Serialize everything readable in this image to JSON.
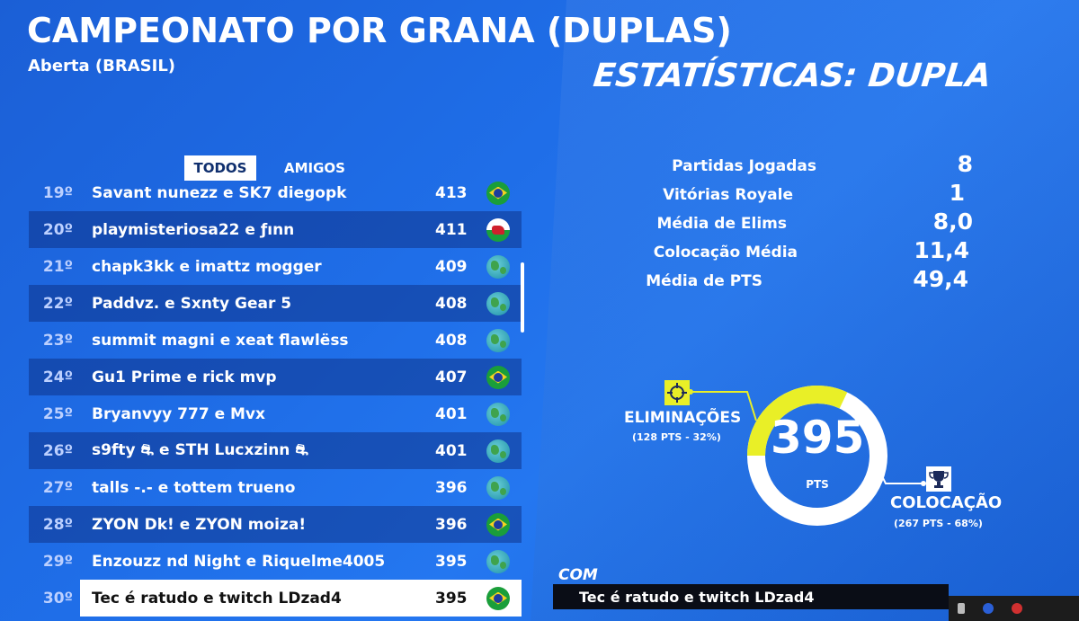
{
  "header": {
    "title": "CAMPEONATO POR GRANA (DUPLAS)",
    "subtitle": "Aberta (BRASIL)",
    "stats_heading": "ESTATÍSTICAS: DUPLA"
  },
  "tabs": [
    {
      "label": "TODOS",
      "active": true
    },
    {
      "label": "AMIGOS",
      "active": false
    }
  ],
  "leaderboard": [
    {
      "rank": "19º",
      "name": "Savant nunezz e SK7 diegopk",
      "score": "413",
      "flag": "brazil-flag-icon"
    },
    {
      "rank": "20º",
      "name": "playmisteriosa22 e ƒınn",
      "score": "411",
      "flag": "wales-flag-icon"
    },
    {
      "rank": "21º",
      "name": "chapk3kk e imattz mogger",
      "score": "409",
      "flag": "globe-icon"
    },
    {
      "rank": "22º",
      "name": "Paddvz. e Sxnty Gear 5",
      "score": "408",
      "flag": "globe-icon"
    },
    {
      "rank": "23º",
      "name": "summit magni e xeat flawlëss",
      "score": "408",
      "flag": "globe-icon"
    },
    {
      "rank": "24º",
      "name": "Gu1 Prime e rick mvp",
      "score": "407",
      "flag": "brazil-flag-icon"
    },
    {
      "rank": "25º",
      "name": "Bryanvyy 777 e Mvx",
      "score": "401",
      "flag": "globe-icon"
    },
    {
      "rank": "26º",
      "name": "s9fty ⛐ e STH Lucxzinn ⛐",
      "score": "401",
      "flag": "globe-icon"
    },
    {
      "rank": "27º",
      "name": "talls -.- e tottem trueno",
      "score": "396",
      "flag": "globe-icon"
    },
    {
      "rank": "28º",
      "name": "ZYON Dk! e ZYON moiza!",
      "score": "396",
      "flag": "brazil-flag-icon"
    },
    {
      "rank": "29º",
      "name": "Enzouzz nd Night e Riquelme4005",
      "score": "395",
      "flag": "globe-icon"
    },
    {
      "rank": "30º",
      "name": "Tec é ratudo e twitch LDzad4",
      "score": "395",
      "flag": "brazil-flag-icon",
      "highlighted": true
    }
  ],
  "stats": [
    {
      "label": "Partidas Jogadas",
      "value": "8"
    },
    {
      "label": "Vitórias Royale",
      "value": "1"
    },
    {
      "label": "Média de Elims",
      "value": "8,0"
    },
    {
      "label": "Colocação Média",
      "value": "11,4"
    },
    {
      "label": "Média de PTS",
      "value": "49,4"
    }
  ],
  "points": {
    "total": "395",
    "unit": "PTS",
    "eliminations_label": "ELIMINAÇÕES",
    "eliminations_detail": "(128 PTS - 32%)",
    "eliminations_fraction": 0.32,
    "placement_label": "COLOCAÇÃO",
    "placement_detail": "(267 PTS - 68%)"
  },
  "footer": {
    "com_label": "COM",
    "team_name": "Tec é ratudo e twitch LDzad4"
  },
  "colors": {
    "accent_yellow": "#e9ef27",
    "background_blue": "#1f6ee8"
  }
}
